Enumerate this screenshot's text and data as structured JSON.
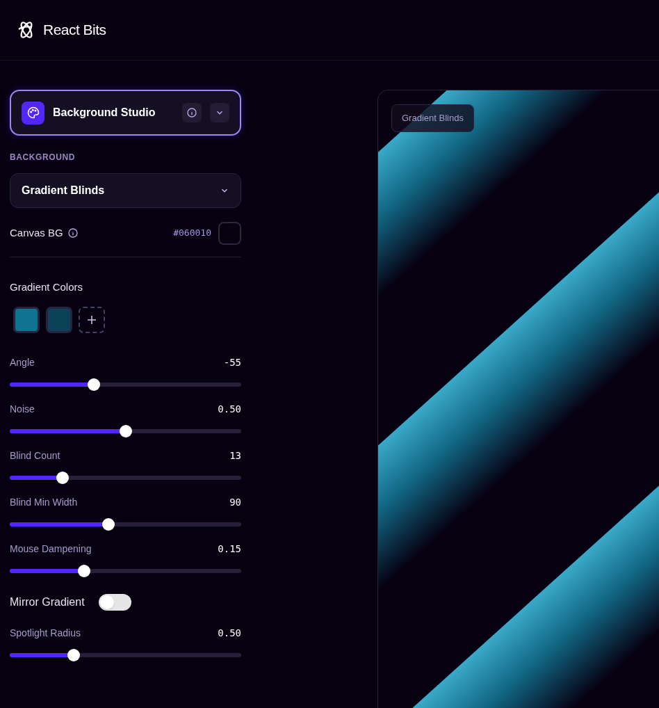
{
  "brand": {
    "name": "React Bits"
  },
  "studio": {
    "title": "Background Studio"
  },
  "section_label": "BACKGROUND",
  "background_select": {
    "value": "Gradient Blinds"
  },
  "canvas_bg": {
    "label": "Canvas BG",
    "value": "#060010",
    "color": "#060010"
  },
  "gradient_colors": {
    "label": "Gradient Colors",
    "swatches": [
      {
        "color": "#0e7490"
      },
      {
        "color": "#0b4257"
      }
    ]
  },
  "controls": [
    {
      "kind": "slider",
      "label": "Angle",
      "reading": "-55",
      "level": 0.354
    },
    {
      "kind": "slider",
      "label": "Noise",
      "reading": "0.50",
      "level": 0.5
    },
    {
      "kind": "slider",
      "label": "Blind Count",
      "reading": "13",
      "level": 0.213
    },
    {
      "kind": "slider",
      "label": "Blind Min Width",
      "reading": "90",
      "level": 0.423
    },
    {
      "kind": "slider",
      "label": "Mouse Dampening",
      "reading": "0.15",
      "level": 0.31
    },
    {
      "kind": "toggle",
      "label": "Mirror Gradient",
      "on": false
    },
    {
      "kind": "slider",
      "label": "Spotlight Radius",
      "reading": "0.50",
      "level": 0.264
    }
  ],
  "preview": {
    "badge": "Gradient Blinds",
    "kind": "picture"
  }
}
